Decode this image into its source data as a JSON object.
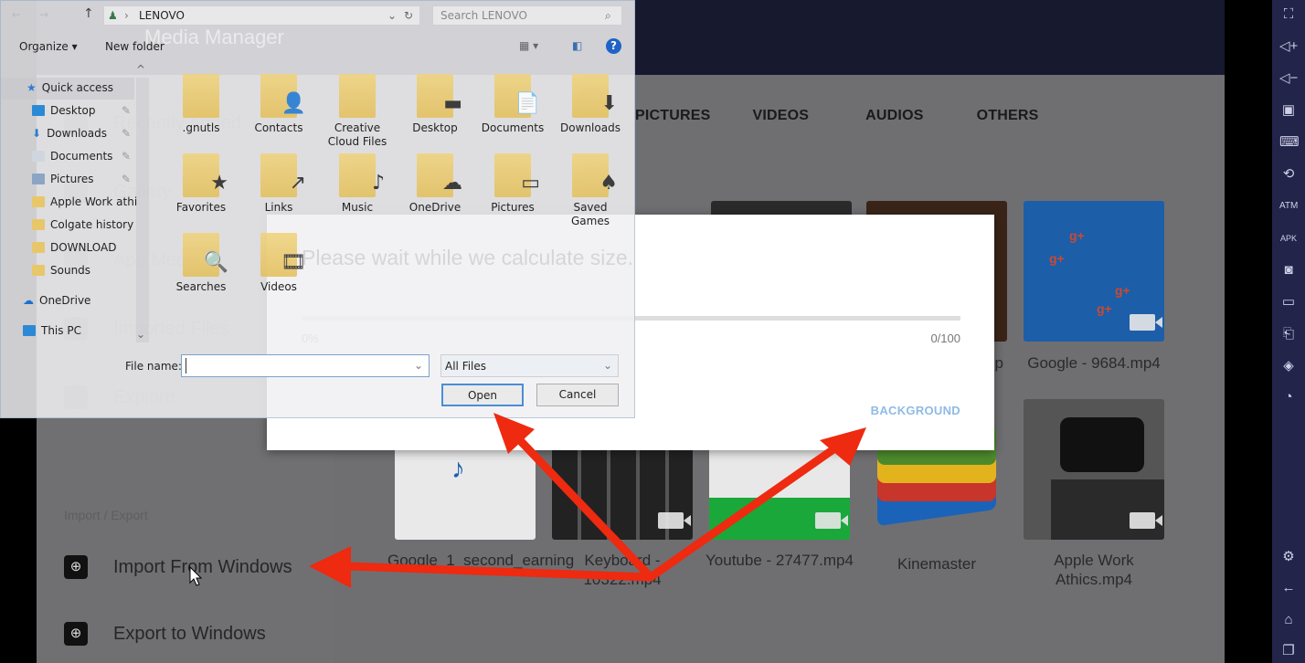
{
  "app": {
    "title": "Media Manager",
    "sidebar_ghost": [
      "Recently Added",
      "Gallery",
      "App Media",
      "Imported Files",
      "Explore"
    ],
    "tabs": [
      "PICTURES",
      "VIDEOS",
      "AUDIOS",
      "OTHERS"
    ],
    "section_label": "Import / Export",
    "import_label": "Import From Windows",
    "export_label": "Export to Windows",
    "tiles": [
      {
        "caption": "Google_1_second_earning"
      },
      {
        "caption": "Keyboard - 10322.mp4"
      },
      {
        "caption": "Youtube - 27477.mp4"
      },
      {
        "caption": "Kinemaster"
      },
      {
        "caption": "Apple Work Athics.mp4"
      },
      {
        "caption": "Google - 9684.mp4"
      },
      {
        "caption": ".jp"
      }
    ]
  },
  "progress_dialog": {
    "message": "Please wait while we calculate size.",
    "percent_label": "0%",
    "count_label": "0/100",
    "progress": 0,
    "background_button": "BACKGROUND",
    "accent": "#8fbbe6"
  },
  "file_dialog": {
    "breadcrumb": "LENOVO",
    "search_placeholder": "Search LENOVO",
    "organize": "Organize ▾",
    "new_folder": "New folder",
    "nav": [
      {
        "label": "Quick access",
        "icon": "star"
      },
      {
        "label": "Desktop",
        "icon": "desktop",
        "pinned": true
      },
      {
        "label": "Downloads",
        "icon": "download",
        "pinned": true
      },
      {
        "label": "Documents",
        "icon": "document",
        "pinned": true
      },
      {
        "label": "Pictures",
        "icon": "picture",
        "pinned": true
      },
      {
        "label": "Apple Work athi",
        "icon": "folder"
      },
      {
        "label": "Colgate history",
        "icon": "folder"
      },
      {
        "label": "DOWNLOAD",
        "icon": "folder"
      },
      {
        "label": "Sounds",
        "icon": "folder"
      },
      {
        "label": "OneDrive",
        "icon": "cloud"
      },
      {
        "label": "This PC",
        "icon": "pc"
      }
    ],
    "folders": [
      {
        "label": ".gnutls",
        "ov": ""
      },
      {
        "label": "Contacts",
        "ov": "👤"
      },
      {
        "label": "Creative Cloud Files",
        "ov": ""
      },
      {
        "label": "Desktop",
        "ov": "▬"
      },
      {
        "label": "Documents",
        "ov": "📄"
      },
      {
        "label": "Downloads",
        "ov": "⬇"
      },
      {
        "label": "Favorites",
        "ov": "★"
      },
      {
        "label": "Links",
        "ov": "↗"
      },
      {
        "label": "Music",
        "ov": "♪"
      },
      {
        "label": "OneDrive",
        "ov": "☁"
      },
      {
        "label": "Pictures",
        "ov": "▭"
      },
      {
        "label": "Saved Games",
        "ov": "♠"
      },
      {
        "label": "Searches",
        "ov": "🔍"
      },
      {
        "label": "Videos",
        "ov": "🎞"
      }
    ],
    "file_name_label": "File name:",
    "file_name_value": "",
    "filter": "All Files",
    "open": "Open",
    "cancel": "Cancel"
  },
  "toolbar": [
    "fullscreen",
    "volume-up",
    "volume-down",
    "cursor",
    "keyboard",
    "macro",
    "atm",
    "apk",
    "screenshot",
    "folder",
    "rotate",
    "layers",
    "speed",
    "settings",
    "back",
    "home",
    "recents"
  ]
}
